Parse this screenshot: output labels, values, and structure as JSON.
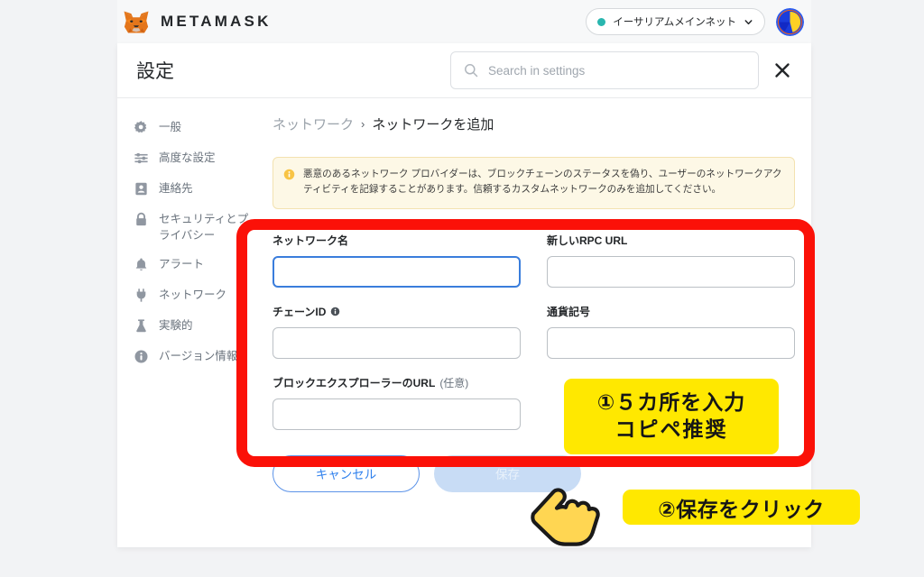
{
  "appbar": {
    "brand": "METAMASK",
    "brand_icon": "metamask-fox-icon",
    "network": {
      "name": "イーサリアムメインネット",
      "status_color": "#29b6af",
      "chevron_icon": "chevron-down-icon"
    },
    "account_avatar_icon": "account-avatar-icon"
  },
  "settings": {
    "title": "設定",
    "search": {
      "placeholder": "Search in settings",
      "value": "",
      "icon": "search-icon"
    },
    "close_icon": "close-icon"
  },
  "sidebar": {
    "items": [
      {
        "label": "一般",
        "icon": "gear-icon"
      },
      {
        "label": "高度な設定",
        "icon": "sliders-icon"
      },
      {
        "label": "連絡先",
        "icon": "contact-card-icon"
      },
      {
        "label": "セキュリティとプライバシー",
        "icon": "lock-icon"
      },
      {
        "label": "アラート",
        "icon": "bell-icon"
      },
      {
        "label": "ネットワーク",
        "icon": "plug-icon"
      },
      {
        "label": "実験的",
        "icon": "flask-icon"
      },
      {
        "label": "バージョン情報",
        "icon": "info-icon"
      }
    ]
  },
  "breadcrumb": {
    "parent": "ネットワーク",
    "separator": "›",
    "current": "ネットワークを追加"
  },
  "warning": {
    "icon": "info-circle-icon",
    "text": "悪意のあるネットワーク プロバイダーは、ブロックチェーンのステータスを偽り、ユーザーのネットワークアクティビティを記録することがあります。信頼するカスタムネットワークのみを追加してください。",
    "bg_color": "#fdf8e6",
    "border_color": "#f3e2b0"
  },
  "form": {
    "fields": [
      {
        "label": "ネットワーク名",
        "value": "",
        "placeholder": "",
        "focused": true
      },
      {
        "label": "新しいRPC URL",
        "value": "",
        "placeholder": "",
        "focused": false
      },
      {
        "label": "チェーンID",
        "value": "",
        "placeholder": "",
        "focused": false,
        "info_icon": "info-icon"
      },
      {
        "label": "通貨記号",
        "value": "",
        "placeholder": "",
        "focused": false
      },
      {
        "label": "ブロックエクスプローラーのURL",
        "optional_suffix": "(任意)",
        "value": "",
        "placeholder": "",
        "focused": false
      }
    ],
    "buttons": {
      "cancel": "キャンセル",
      "save": "保存"
    }
  },
  "annotations": {
    "highlight_color": "#fb1108",
    "note_bg": "#ffe800",
    "note1_line1": "①５カ所を入力",
    "note1_line2": "コピペ推奨",
    "note2": "②保存をクリック",
    "cursor_icon": "pointing-hand-cursor-icon"
  }
}
